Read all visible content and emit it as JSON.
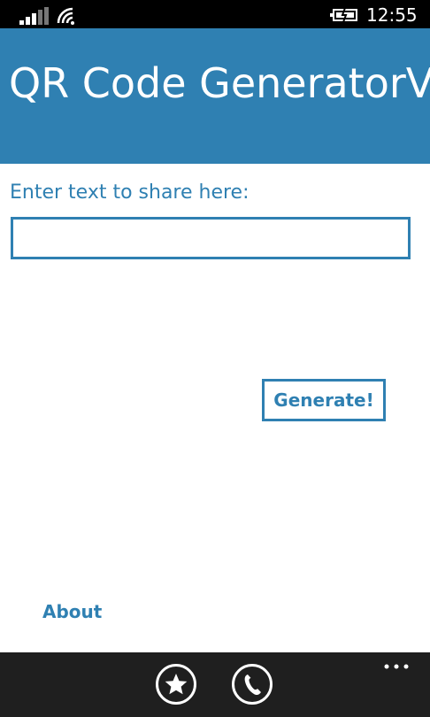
{
  "status_bar": {
    "time": "12:55",
    "icons": [
      "signal-strength-icon",
      "wifi-icon",
      "battery-charging-icon"
    ]
  },
  "header": {
    "title": "QR Code GeneratorV"
  },
  "form": {
    "prompt_label": "Enter text to share here:",
    "input_value": "",
    "generate_label": "Generate!"
  },
  "footer": {
    "about_label": "About"
  },
  "app_bar": {
    "buttons": [
      "star-icon",
      "phone-icon"
    ],
    "more_icon": "ellipsis-icon"
  },
  "colors": {
    "accent": "#2f80b2",
    "status_bar": "#000000",
    "app_bar": "#1f1f1f",
    "background": "#ffffff"
  }
}
